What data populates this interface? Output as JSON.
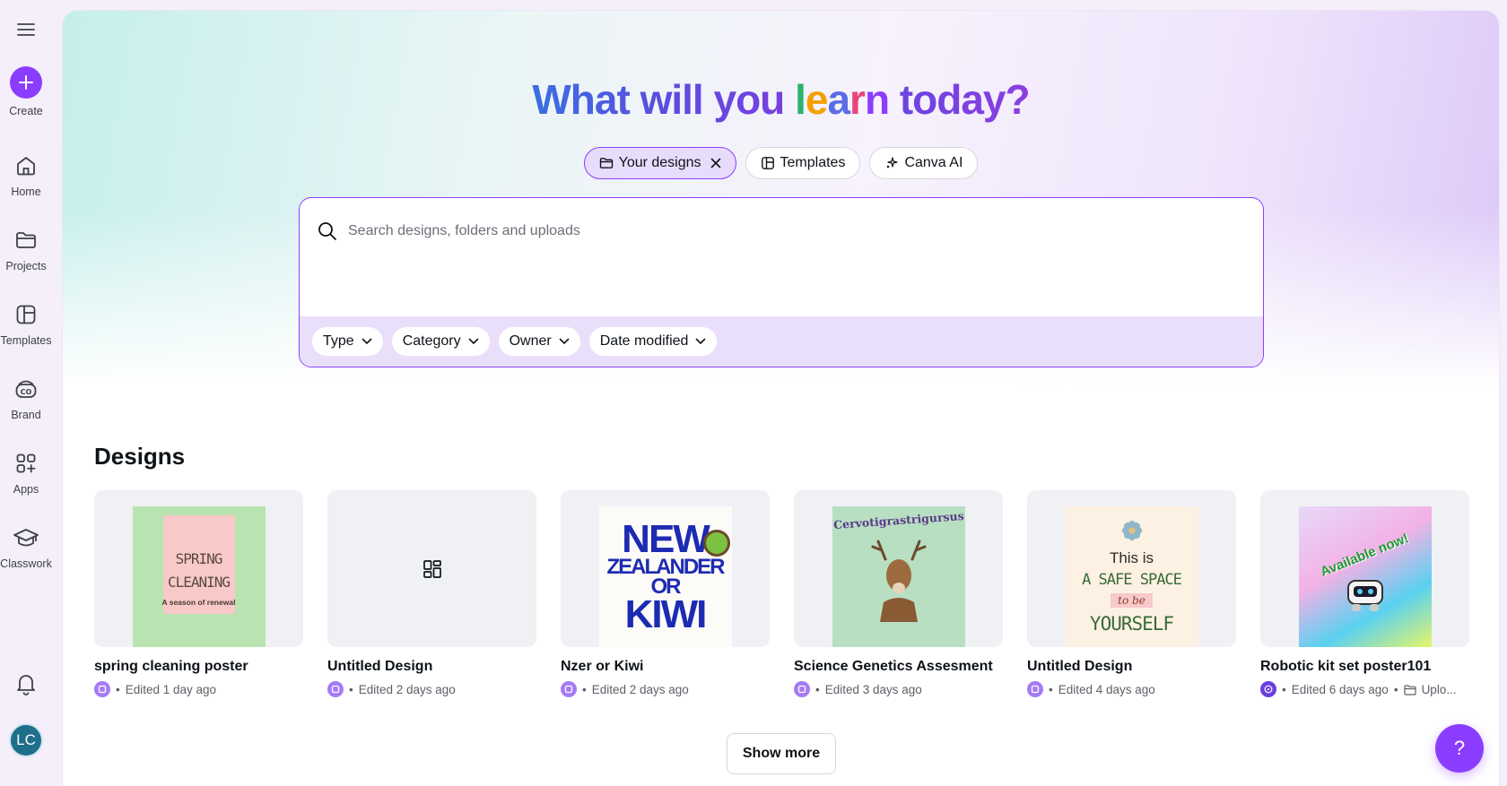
{
  "sidebar": {
    "create_label": "Create",
    "items": [
      {
        "label": "Home",
        "icon": "home-icon"
      },
      {
        "label": "Projects",
        "icon": "folder-icon"
      },
      {
        "label": "Templates",
        "icon": "templates-icon"
      },
      {
        "label": "Brand",
        "icon": "brand-icon"
      },
      {
        "label": "Apps",
        "icon": "apps-icon"
      },
      {
        "label": "Classwork",
        "icon": "graduation-cap-icon"
      }
    ],
    "avatar_initials": "LC"
  },
  "hero": {
    "headline_start": "What will you ",
    "headline_word": [
      "l",
      "e",
      "a",
      "r",
      "n"
    ],
    "headline_end": " today?"
  },
  "chips": {
    "your_designs": "Your designs",
    "templates": "Templates",
    "canva_ai": "Canva AI"
  },
  "search": {
    "placeholder": "Search designs, folders and uploads",
    "filters": [
      "Type",
      "Category",
      "Owner",
      "Date modified"
    ]
  },
  "designs": {
    "title": "Designs",
    "items": [
      {
        "title": "spring cleaning poster",
        "meta": "Edited 1 day ago",
        "poster": {
          "line1": "SPRING",
          "line2": "CLEANING",
          "sub": "A season of renewal"
        }
      },
      {
        "title": "Untitled Design",
        "meta": "Edited 2 days ago"
      },
      {
        "title": "Nzer or Kiwi",
        "meta": "Edited 2 days ago",
        "poster": {
          "line1": "NEW",
          "line2": "ZEALANDER",
          "line3": "OR",
          "line4": "KIWI"
        }
      },
      {
        "title": "Science Genetics Assesment",
        "meta": "Edited 3 days ago",
        "poster": {
          "line1": "Cervotigrastrigursus"
        }
      },
      {
        "title": "Untitled Design",
        "meta": "Edited 4 days ago",
        "poster": {
          "line1": "This is",
          "line2": "A SAFE SPACE",
          "line3": "to be",
          "line4": "YOURSELF"
        }
      },
      {
        "title": "Robotic kit set poster101",
        "meta": "Edited 6 days ago",
        "extra": "Uplo...",
        "poster": {
          "line1": "Available now!"
        }
      }
    ],
    "show_more": "Show more"
  },
  "help": {
    "label": "?"
  },
  "colors": {
    "accent": "#8b3dff",
    "chip_active_bg": "#e8dcfc",
    "filter_bar_bg": "#eadffb"
  }
}
